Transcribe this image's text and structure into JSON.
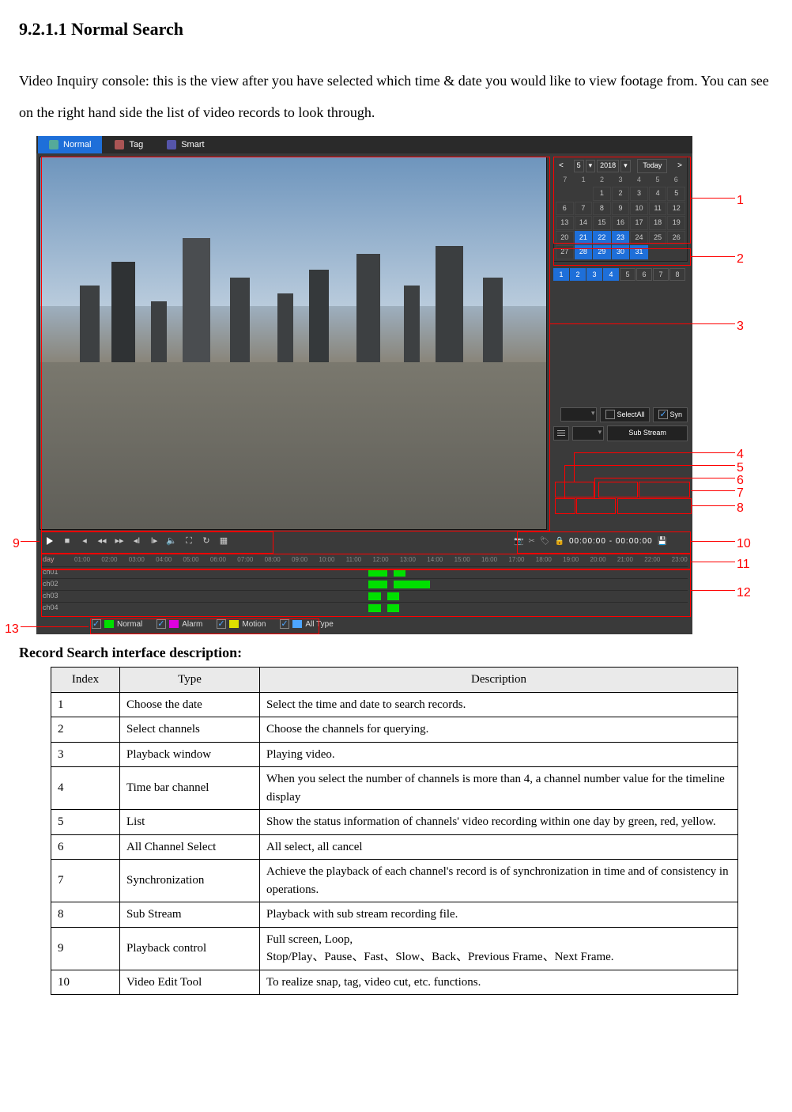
{
  "heading": "9.2.1.1 Normal Search",
  "intro": "Video Inquiry console: this is the view after you have selected which time & date you would like to view footage from. You can see on the right hand side the list of video records to look through.",
  "app": {
    "tabs": [
      {
        "label": "Normal",
        "active": true
      },
      {
        "label": "Tag",
        "active": false
      },
      {
        "label": "Smart",
        "active": false
      }
    ],
    "calendar": {
      "month": "5",
      "year": "2018",
      "today_label": "Today",
      "dow": [
        "7",
        "1",
        "2",
        "3",
        "4",
        "5",
        "6"
      ],
      "rows": [
        [
          "",
          "",
          "1",
          "2",
          "3",
          "4",
          "5"
        ],
        [
          "6",
          "7",
          "8",
          "9",
          "10",
          "11",
          "12"
        ],
        [
          "13",
          "14",
          "15",
          "16",
          "17",
          "18",
          "19"
        ],
        [
          "20",
          "21",
          "22",
          "23",
          "24",
          "25",
          "26"
        ],
        [
          "27",
          "28",
          "29",
          "30",
          "31",
          "",
          ""
        ]
      ],
      "selected": [
        "21",
        "22",
        "23",
        "28",
        "29",
        "30",
        "31"
      ]
    },
    "channels": {
      "count": 8,
      "selected": [
        1,
        2,
        3,
        4
      ]
    },
    "options": {
      "select_all_label": "SelectAll",
      "syn_label": "Syn",
      "sub_stream_label": "Sub Stream"
    },
    "edit": {
      "time_range": "00:00:00  -  00:00:00"
    },
    "timeline": {
      "day_label": "day",
      "hours": [
        "01:00",
        "02:00",
        "03:00",
        "04:00",
        "05:00",
        "06:00",
        "07:00",
        "08:00",
        "09:00",
        "10:00",
        "11:00",
        "12:00",
        "13:00",
        "14:00",
        "15:00",
        "16:00",
        "17:00",
        "18:00",
        "19:00",
        "20:00",
        "21:00",
        "22:00",
        "23:00"
      ],
      "rows": [
        {
          "label": "ch01",
          "segs": [
            {
              "l": 48,
              "w": 3
            },
            {
              "l": 52,
              "w": 2
            }
          ]
        },
        {
          "label": "ch02",
          "segs": [
            {
              "l": 48,
              "w": 3
            },
            {
              "l": 52,
              "w": 6
            }
          ]
        },
        {
          "label": "ch03",
          "segs": [
            {
              "l": 48,
              "w": 2
            },
            {
              "l": 51,
              "w": 2
            }
          ]
        },
        {
          "label": "ch04",
          "segs": [
            {
              "l": 48,
              "w": 2
            },
            {
              "l": 51,
              "w": 2
            }
          ]
        }
      ]
    },
    "legend": [
      {
        "label": "Normal",
        "color": "#00e000"
      },
      {
        "label": "Alarm",
        "color": "#e000e0"
      },
      {
        "label": "Motion",
        "color": "#e0e000"
      },
      {
        "label": "All Type",
        "color": "#4da6ff"
      }
    ]
  },
  "callouts": [
    "1",
    "2",
    "3",
    "4",
    "5",
    "6",
    "7",
    "8",
    "9",
    "10",
    "11",
    "12",
    "13"
  ],
  "table_title": "Record Search interface description:",
  "table": {
    "headers": [
      "Index",
      "Type",
      "Description"
    ],
    "rows": [
      {
        "i": "1",
        "t": "Choose the date",
        "d": "Select the time and date to search records."
      },
      {
        "i": "2",
        "t": "Select channels",
        "d": "Choose the channels for querying."
      },
      {
        "i": "3",
        "t": "Playback window",
        "d": "Playing video."
      },
      {
        "i": "4",
        "t": "Time bar channel",
        "d": "When you select the number of channels is more than 4, a channel number value for the timeline display"
      },
      {
        "i": "5",
        "t": "List",
        "d": "Show the status information of channels' video recording within one day by green, red, yellow."
      },
      {
        "i": "6",
        "t": "All Channel Select",
        "d": "All select, all cancel"
      },
      {
        "i": "7",
        "t": "Synchronization",
        "d": "Achieve the playback of each channel's record is of synchronization in time and of consistency in operations."
      },
      {
        "i": "8",
        "t": "Sub Stream",
        "d": "Playback with sub stream recording file."
      },
      {
        "i": "9",
        "t": "Playback control",
        "d": "Full screen, Loop,\nStop/Play、Pause、Fast、Slow、Back、Previous Frame、Next Frame."
      },
      {
        "i": "10",
        "t": "Video Edit Tool",
        "d": "To realize snap, tag, video cut, etc. functions."
      }
    ]
  }
}
